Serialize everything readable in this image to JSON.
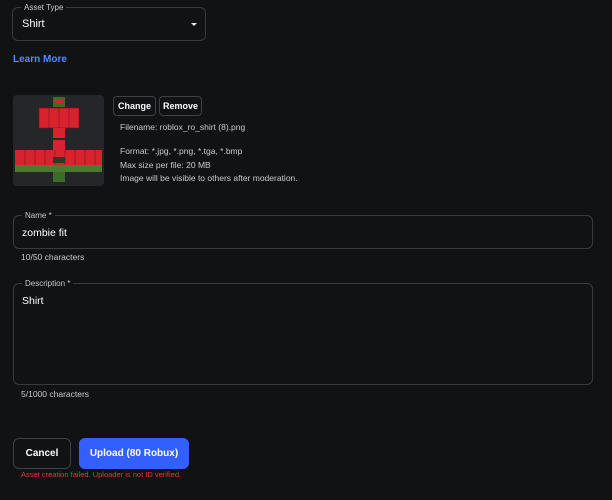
{
  "asset_type": {
    "legend": "Asset Type",
    "value": "Shirt"
  },
  "learn_more": "Learn More",
  "upload": {
    "change_label": "Change",
    "remove_label": "Remove",
    "filename_line": "Filename: roblox_ro_shirt (8).png",
    "format_line": "Format: *.jpg, *.png, *.tga, *.bmp",
    "max_size_line": "Max size per file: 20 MB",
    "visibility_line": "Image will be visible to others after moderation."
  },
  "name_field": {
    "legend": "Name *",
    "value": "zombie fit",
    "counter": "10/50 characters"
  },
  "description_field": {
    "legend": "Description *",
    "value": "Shirt",
    "counter": "5/1000 characters"
  },
  "actions": {
    "cancel_label": "Cancel",
    "upload_label": "Upload (80 Robux)",
    "error_message": "Asset creation failed. Uploader is not ID verified."
  },
  "colors": {
    "background": "#111214",
    "accent": "#335fff",
    "link": "#4f8df9",
    "error": "#e0393e",
    "shirt_red": "#d8232f",
    "shirt_green": "#3f6b2a"
  },
  "icons": {
    "select_caret": "chevron-down-icon"
  }
}
